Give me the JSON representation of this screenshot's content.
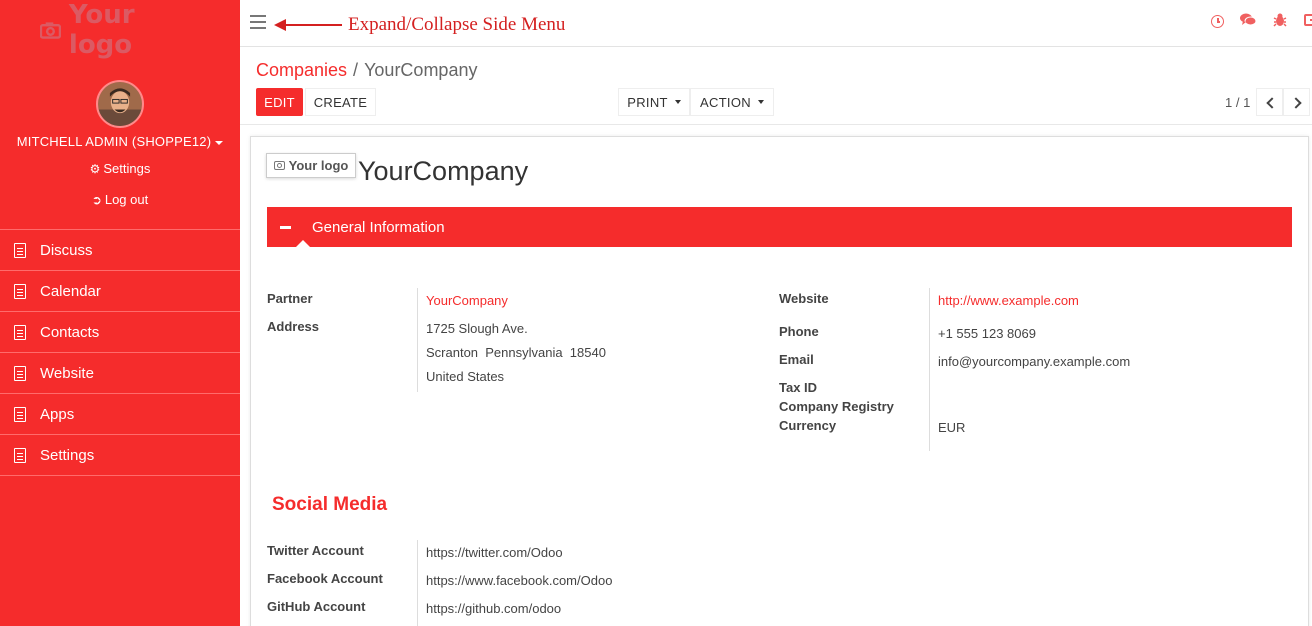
{
  "sidebar": {
    "logo_text": "Your logo",
    "username": "MITCHELL ADMIN (SHOPPE12)",
    "settings_label": "Settings",
    "logout_label": "Log out",
    "menu": [
      {
        "label": "Discuss"
      },
      {
        "label": "Calendar"
      },
      {
        "label": "Contacts"
      },
      {
        "label": "Website"
      },
      {
        "label": "Apps"
      },
      {
        "label": "Settings"
      }
    ]
  },
  "topbar": {
    "annotation": "Expand/Collapse Side Menu"
  },
  "breadcrumb": {
    "parent": "Companies",
    "separator": "/",
    "current": "YourCompany"
  },
  "buttons": {
    "edit": "EDIT",
    "create": "CREATE",
    "print": "PRINT",
    "action": "ACTION"
  },
  "pager": {
    "value": "1 / 1"
  },
  "form": {
    "logo_label": "Your logo",
    "title": "YourCompany",
    "section_general": "General Information",
    "fields_left": [
      {
        "label": "Partner",
        "value": "YourCompany"
      },
      {
        "label": "Address",
        "lines": [
          "1725 Slough Ave.",
          "Scranton  Pennsylvania  18540",
          "United States"
        ]
      }
    ],
    "fields_right": [
      {
        "label": "Website",
        "value": "http://www.example.com"
      },
      {
        "label": "Phone",
        "value": "+1 555 123 8069"
      },
      {
        "label": "Email",
        "value": "info@yourcompany.example.com"
      },
      {
        "label": "Tax ID",
        "value": ""
      },
      {
        "label": "Company Registry",
        "value": ""
      },
      {
        "label": "Currency",
        "value": "EUR"
      }
    ],
    "section_social": "Social Media",
    "social": [
      {
        "label": "Twitter Account",
        "value": "https://twitter.com/Odoo"
      },
      {
        "label": "Facebook Account",
        "value": "https://www.facebook.com/Odoo"
      },
      {
        "label": "GitHub Account",
        "value": "https://github.com/odoo"
      }
    ]
  },
  "colors": {
    "accent": "#f52c2c",
    "annotation": "#d42020"
  }
}
